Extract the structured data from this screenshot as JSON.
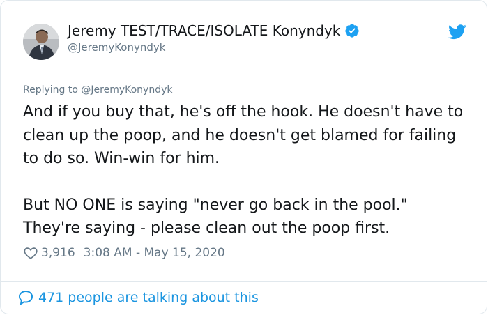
{
  "author": {
    "display_name": "Jeremy TEST/TRACE/ISOLATE Konyndyk",
    "handle": "@JeremyKonyndyk",
    "avatar_icon": "person-avatar-icon",
    "verified_icon": "verified-badge-icon"
  },
  "reply_to": {
    "prefix": "Replying to ",
    "handle": "@JeremyKonyndyk"
  },
  "tweet": {
    "paragraph1": "And if you buy that, he's off the hook. He doesn't have to clean up the poop, and he doesn't get blamed for failing to do so. Win-win for him.",
    "paragraph2": "But NO ONE is saying \"never go back in the pool.\" They're saying - please clean out the poop first."
  },
  "meta": {
    "likes": "3,916",
    "timestamp": "3:08 AM - May 15, 2020"
  },
  "footer": {
    "talking_label": "471 people are talking about this"
  },
  "colors": {
    "link_blue": "#1b95e0",
    "twitter_blue": "#1da1f2",
    "muted_gray": "#657786",
    "text_dark": "#14171a",
    "border": "#e1e8ed"
  }
}
